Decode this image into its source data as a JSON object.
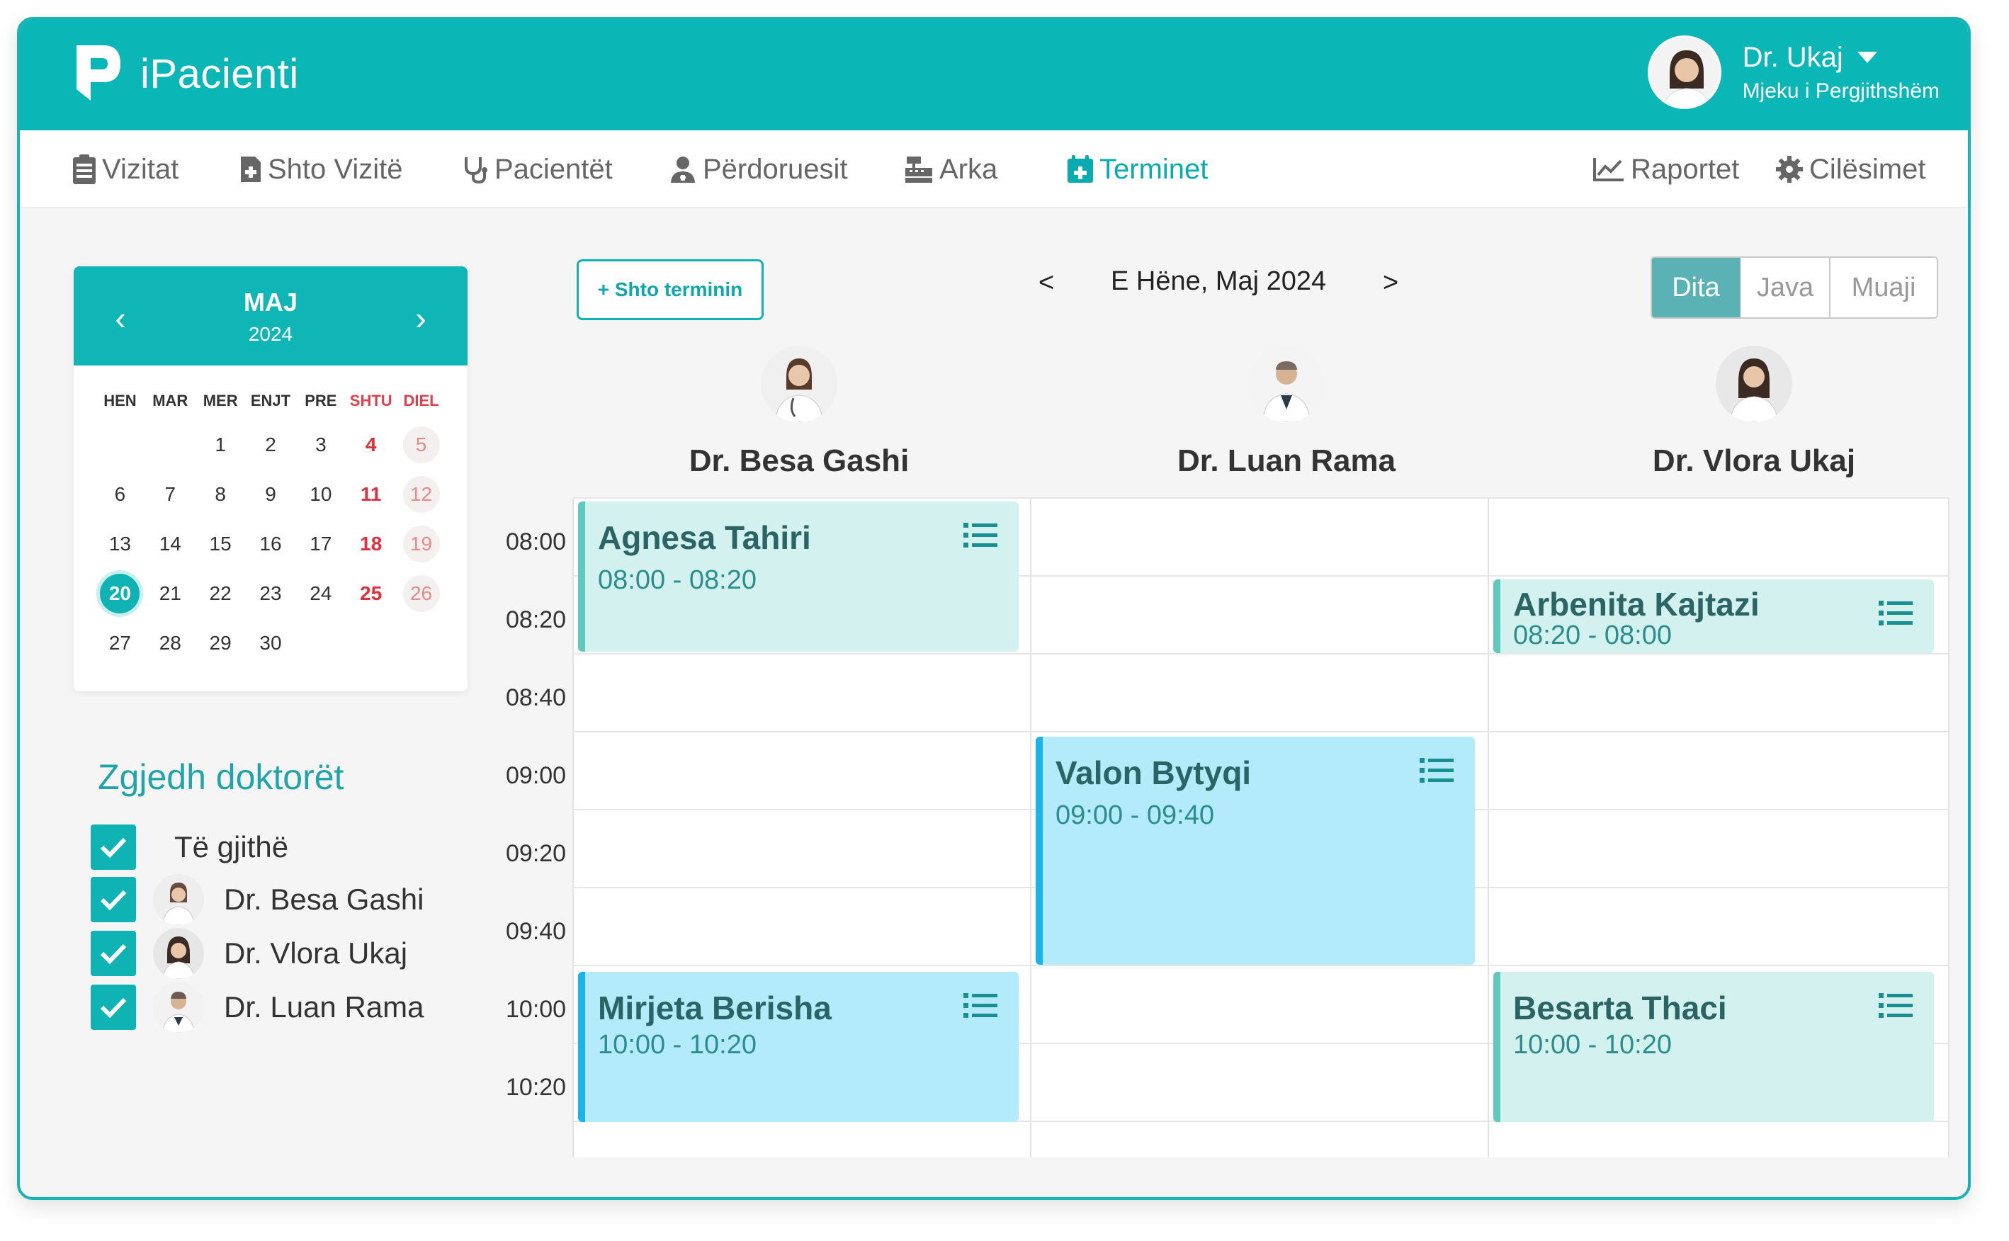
{
  "app": {
    "name": "iPacienti"
  },
  "user": {
    "name": "Dr. Ukaj",
    "role": "Mjeku i Pergjithshëm"
  },
  "nav": {
    "vizitat": "Vizitat",
    "shto_vizite": "Shto Vizitë",
    "pacientet": "Pacientët",
    "perdoruesit": "Përdoruesit",
    "arka": "Arka",
    "terminet": "Terminet",
    "raportet": "Raportet",
    "cilesimet": "Cilësimet",
    "active": "Terminet"
  },
  "mini_calendar": {
    "month": "MAJ",
    "year": "2024",
    "prev": "‹",
    "next": "›",
    "weekdays": [
      "HEN",
      "MAR",
      "MER",
      "ENJT",
      "PRE",
      "SHTU",
      "DIEL"
    ],
    "leading_blanks": 2,
    "days": [
      "1",
      "2",
      "3",
      "4",
      "5",
      "6",
      "7",
      "8",
      "9",
      "10",
      "11",
      "12",
      "13",
      "14",
      "15",
      "16",
      "17",
      "18",
      "19",
      "20",
      "21",
      "22",
      "23",
      "24",
      "25",
      "26",
      "27",
      "28",
      "29",
      "30"
    ],
    "today": "20"
  },
  "filter": {
    "title": "Zgjedh doktorët",
    "all_label": "Të gjithë",
    "doctors": [
      "Dr. Besa Gashi",
      "Dr. Vlora Ukaj",
      "Dr. Luan Rama"
    ]
  },
  "toolbar": {
    "add_label": "+ Shto terminin",
    "prev": "<",
    "next": ">",
    "date": "E Hëne, Maj 2024",
    "views": [
      "Dita",
      "Java",
      "Muaji"
    ],
    "active_view": "Dita"
  },
  "schedule": {
    "columns": [
      "Dr. Besa Gashi",
      "Dr. Luan Rama",
      "Dr. Vlora Ukaj"
    ],
    "times": [
      "08:00",
      "08:20",
      "08:40",
      "09:00",
      "09:20",
      "09:40",
      "10:00",
      "10:20"
    ],
    "events": [
      {
        "patient": "Agnesa Tahiri",
        "time": "08:00 - 08:20",
        "doctor": "Dr. Besa Gashi",
        "style": "green"
      },
      {
        "patient": "Arbenita Kajtazi",
        "time": "08:20 - 08:00",
        "doctor": "Dr. Vlora Ukaj",
        "style": "green"
      },
      {
        "patient": "Valon Bytyqi",
        "time": "09:00 - 09:40",
        "doctor": "Dr. Luan Rama",
        "style": "blue"
      },
      {
        "patient": "Mirjeta Berisha",
        "time": "10:00 - 10:20",
        "doctor": "Dr. Besa Gashi",
        "style": "blue"
      },
      {
        "patient": "Besarta Thaci",
        "time": "10:00 - 10:20",
        "doctor": "Dr. Vlora Ukaj",
        "style": "green"
      }
    ]
  },
  "colors": {
    "brand": "#0bb6b6",
    "event_green": "#d3f1ee",
    "event_blue": "#b3ebfb",
    "weekend": "#e0303c"
  }
}
